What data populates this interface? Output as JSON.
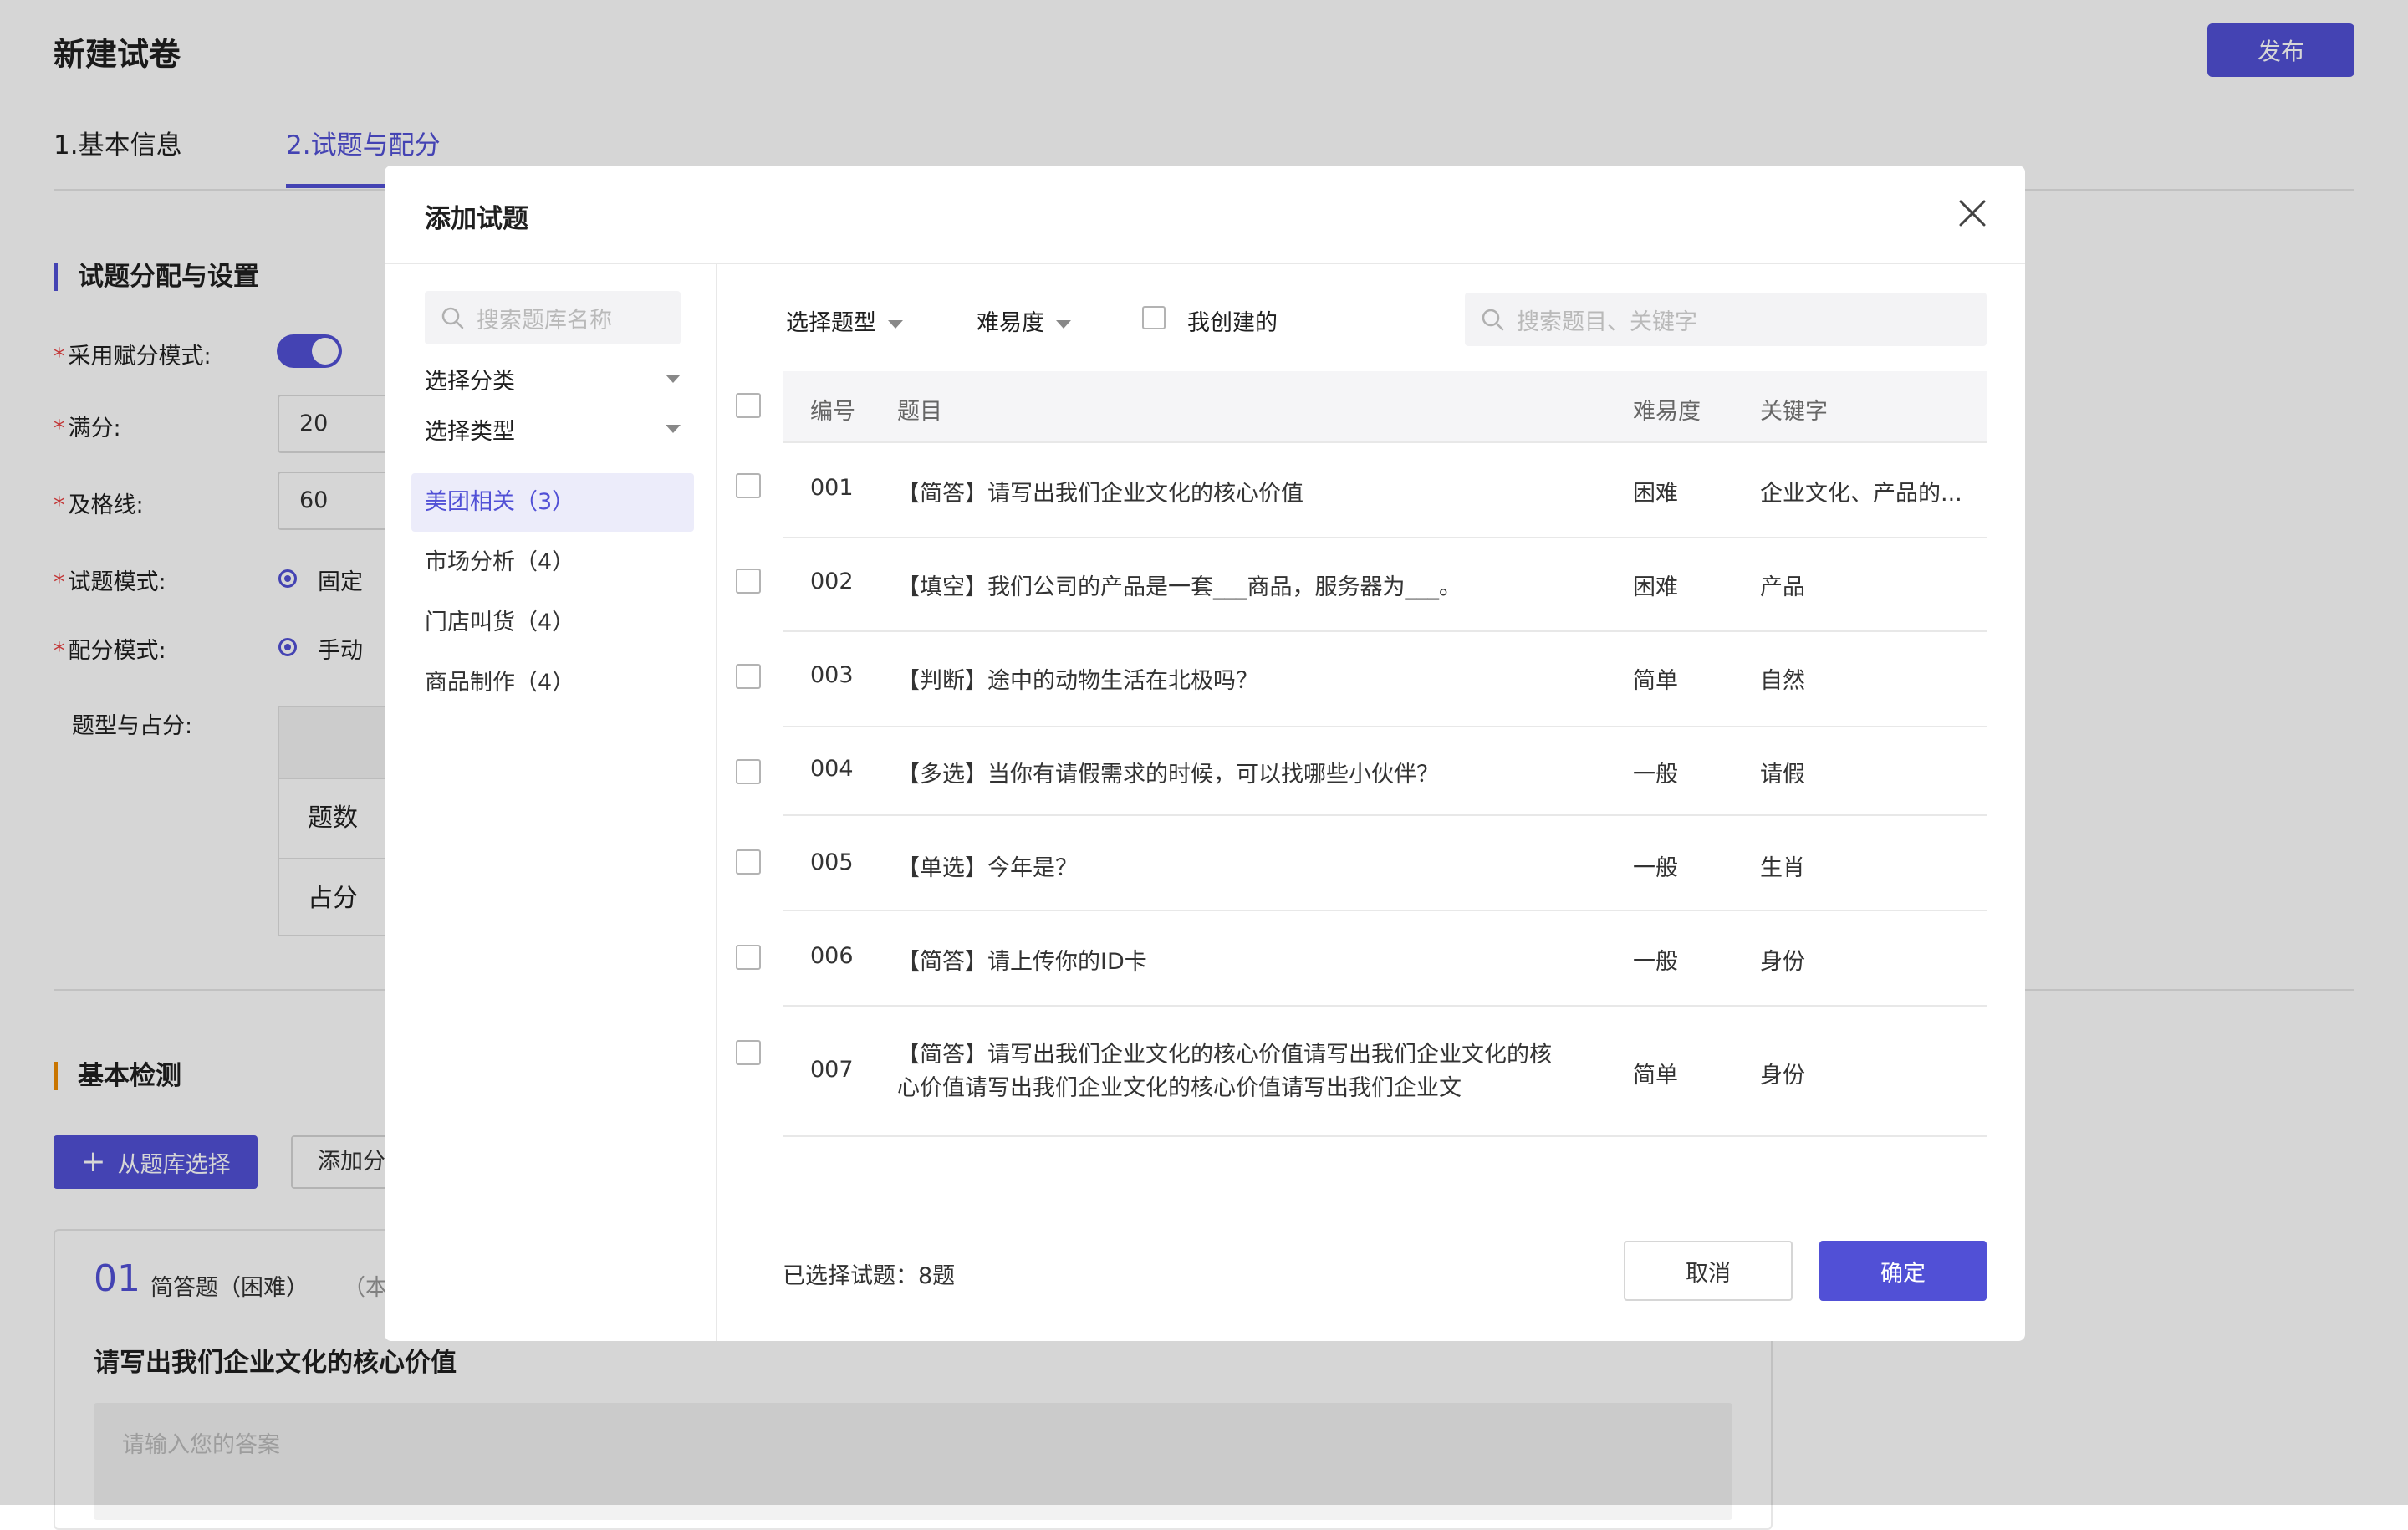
{
  "page": {
    "title": "新建试卷",
    "publish_label": "发布",
    "steps": [
      "1.基本信息",
      "2.试题与配分"
    ],
    "section_assign_title": "试题分配与设置",
    "form": {
      "scoring_mode_label": "采用赋分模式:",
      "full_score_label": "满分:",
      "full_score_value": "20",
      "pass_line_label": "及格线:",
      "pass_line_value": "60",
      "question_mode_label": "试题模式:",
      "question_mode_value": "固定",
      "score_mode_label": "配分模式:",
      "score_mode_value": "手动",
      "type_score_label": "题型与占分:",
      "table_rows": [
        "题数",
        "占分"
      ]
    },
    "section_check_title": "基本检测",
    "from_bank_label": "从题库选择",
    "add_category_label": "添加分",
    "question_card": {
      "number": "01",
      "type": "简答题（困难）",
      "note": "（本题",
      "text": "请写出我们企业文化的核心价值",
      "answer_placeholder": "请输入您的答案"
    }
  },
  "modal": {
    "title": "添加试题",
    "left": {
      "search_placeholder": "搜索题库名称",
      "select_category": "选择分类",
      "select_type": "选择类型",
      "categories": [
        {
          "label": "美团相关（3）",
          "active": true
        },
        {
          "label": "市场分析（4）",
          "active": false
        },
        {
          "label": "门店叫货（4）",
          "active": false
        },
        {
          "label": "商品制作（4）",
          "active": false
        }
      ]
    },
    "filters": {
      "question_type": "选择题型",
      "difficulty": "难易度",
      "created_by_me": "我创建的",
      "search_placeholder": "搜索题目、关键字"
    },
    "table": {
      "headers": {
        "id": "编号",
        "question": "题目",
        "difficulty": "难易度",
        "keyword": "关键字"
      },
      "rows": [
        {
          "id": "001",
          "question": "【简答】请写出我们企业文化的核心价值",
          "difficulty": "困难",
          "keyword": "企业文化、产品的..."
        },
        {
          "id": "002",
          "question": "【填空】我们公司的产品是一套___商品，服务器为___。",
          "difficulty": "困难",
          "keyword": "产品"
        },
        {
          "id": "003",
          "question": "【判断】途中的动物生活在北极吗？",
          "difficulty": "简单",
          "keyword": "自然"
        },
        {
          "id": "004",
          "question": "【多选】当你有请假需求的时候，可以找哪些小伙伴？",
          "difficulty": "一般",
          "keyword": "请假"
        },
        {
          "id": "005",
          "question": "【单选】今年是？",
          "difficulty": "一般",
          "keyword": "生肖"
        },
        {
          "id": "006",
          "question": "【简答】请上传你的ID卡",
          "difficulty": "一般",
          "keyword": "身份"
        },
        {
          "id": "007",
          "question": "【简答】请写出我们企业文化的核心价值请写出我们企业文化的核心价值请写出我们企业文化的核心价值请写出我们企业文",
          "difficulty": "简单",
          "keyword": "身份"
        }
      ]
    },
    "footer": {
      "selected_info": "已选择试题：8题",
      "cancel_label": "取消",
      "ok_label": "确定"
    }
  },
  "colors": {
    "accent": "#5150d6",
    "required": "#e84040",
    "section_orange": "#f08c00"
  }
}
